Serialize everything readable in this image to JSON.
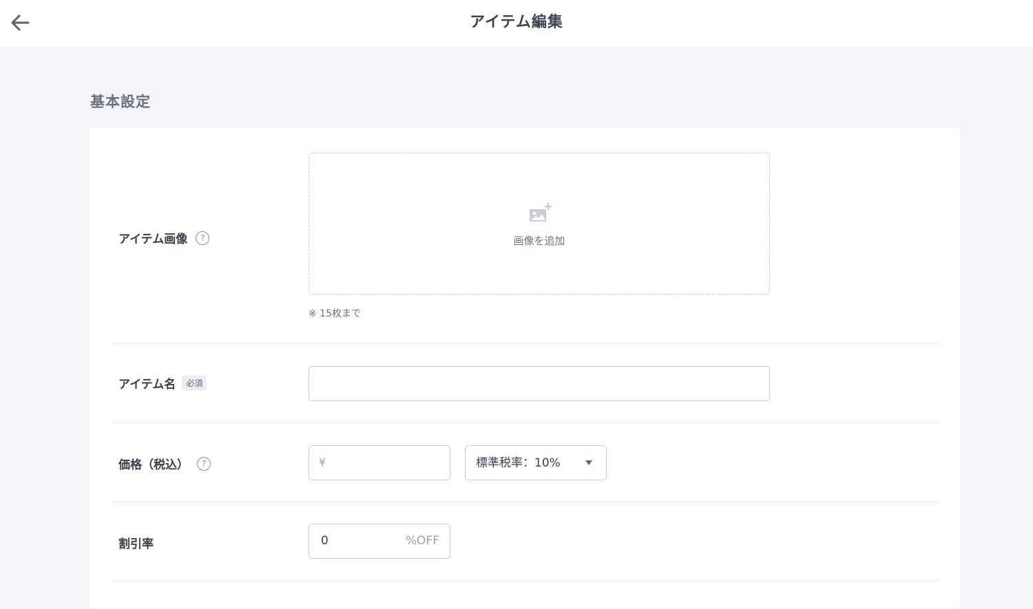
{
  "header": {
    "title": "アイテム編集",
    "back_icon": "arrow-left-icon"
  },
  "section": {
    "title": "基本設定"
  },
  "form": {
    "image": {
      "label": "アイテム画像",
      "help": "?",
      "add_label": "画像を追加",
      "note": "※ 15枚まで",
      "icon": "image-add-icon"
    },
    "name": {
      "label": "アイテム名",
      "required_badge": "必須",
      "value": "",
      "placeholder": ""
    },
    "price": {
      "label": "価格（税込）",
      "help": "?",
      "currency_symbol": "¥",
      "value": "",
      "tax_rate_selected": "標準税率：10%"
    },
    "discount": {
      "label": "割引率",
      "value": "0",
      "suffix": "%OFF"
    }
  },
  "colors": {
    "background": "#f4f5f9",
    "card": "#ffffff",
    "text": "#3a3f4b",
    "muted": "#6f7482"
  }
}
